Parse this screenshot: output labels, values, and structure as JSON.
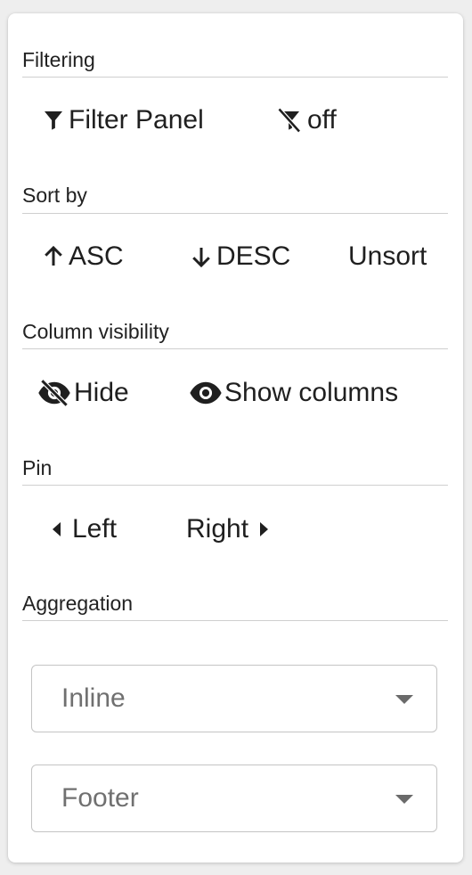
{
  "sections": {
    "filtering": {
      "title": "Filtering",
      "filter_panel_label": "Filter Panel",
      "filter_off_label": "off"
    },
    "sort": {
      "title": "Sort by",
      "asc_label": "ASC",
      "desc_label": "DESC",
      "unsort_label": "Unsort"
    },
    "visibility": {
      "title": "Column visibility",
      "hide_label": "Hide",
      "show_columns_label": "Show columns"
    },
    "pin": {
      "title": "Pin",
      "left_label": "Left",
      "right_label": "Right"
    },
    "aggregation": {
      "title": "Aggregation",
      "inline_value": "Inline",
      "footer_value": "Footer"
    }
  },
  "icons": {
    "filter": "filter-icon",
    "filter_off": "filter-off-icon",
    "arrow_up": "arrow-up-icon",
    "arrow_down": "arrow-down-icon",
    "eye_off": "eye-off-icon",
    "eye": "eye-icon",
    "caret_left": "caret-left-icon",
    "caret_right": "caret-right-icon",
    "dropdown": "chevron-down-icon"
  },
  "colors": {
    "text": "#1f1f1f",
    "divider": "#cfcfcf",
    "select_text": "#707070",
    "background": "#eeeeee",
    "panel": "#ffffff"
  }
}
